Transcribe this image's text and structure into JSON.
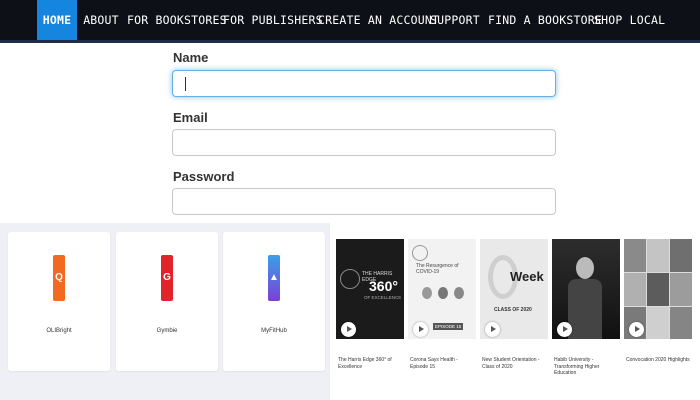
{
  "nav": {
    "items": [
      {
        "label": "HOME"
      },
      {
        "label": "ABOUT"
      },
      {
        "label": "FOR BOOKSTORES"
      },
      {
        "label": "FOR PUBLISHERS"
      },
      {
        "label": "CREATE AN ACCOUNT"
      },
      {
        "label": "SUPPORT"
      },
      {
        "label": "FIND A BOOKSTORE"
      },
      {
        "label": "SHOP LOCAL"
      }
    ],
    "active_index": 0
  },
  "form": {
    "name_label": "Name",
    "name_value": "",
    "email_label": "Email",
    "email_value": "",
    "password_label": "Password",
    "password_value": ""
  },
  "apps": [
    {
      "name": "OLIBright",
      "icon": "orange-app-icon",
      "color": "#f26a21",
      "glyph": "Q"
    },
    {
      "name": "Gymbie",
      "icon": "red-app-icon",
      "color": "#e0242a",
      "glyph": "G"
    },
    {
      "name": "MyFitHub",
      "icon": "blue-app-icon",
      "color": "#3a7bd5",
      "glyph": "▲"
    }
  ],
  "videos": [
    {
      "thumb_heading": "THE HARRIS EDGE",
      "thumb_big": "360°",
      "thumb_sub": "OF EXCELLENCE",
      "title": "The Harris Edge 360° of Excellence"
    },
    {
      "thumb_heading": "The Resurgence of COVID-19",
      "thumb_big": "",
      "thumb_sub": "EPISODE 15",
      "title": "Corona Says Health - Episode 15"
    },
    {
      "thumb_heading": "",
      "thumb_big": "Week",
      "thumb_sub": "CLASS OF 2020",
      "title": "New Student Orientation - Class of 2020"
    },
    {
      "thumb_heading": "",
      "thumb_big": "",
      "thumb_sub": "",
      "title": "Habib University - Transforming Higher Education"
    },
    {
      "thumb_heading": "",
      "thumb_big": "",
      "thumb_sub": "",
      "title": "Convocation 2020 Highlights"
    }
  ],
  "colors": {
    "nav_bg": "#0d1117",
    "nav_active": "#1585e0",
    "focus_ring": "#66afe9",
    "panel_bg": "#eef0f6"
  }
}
